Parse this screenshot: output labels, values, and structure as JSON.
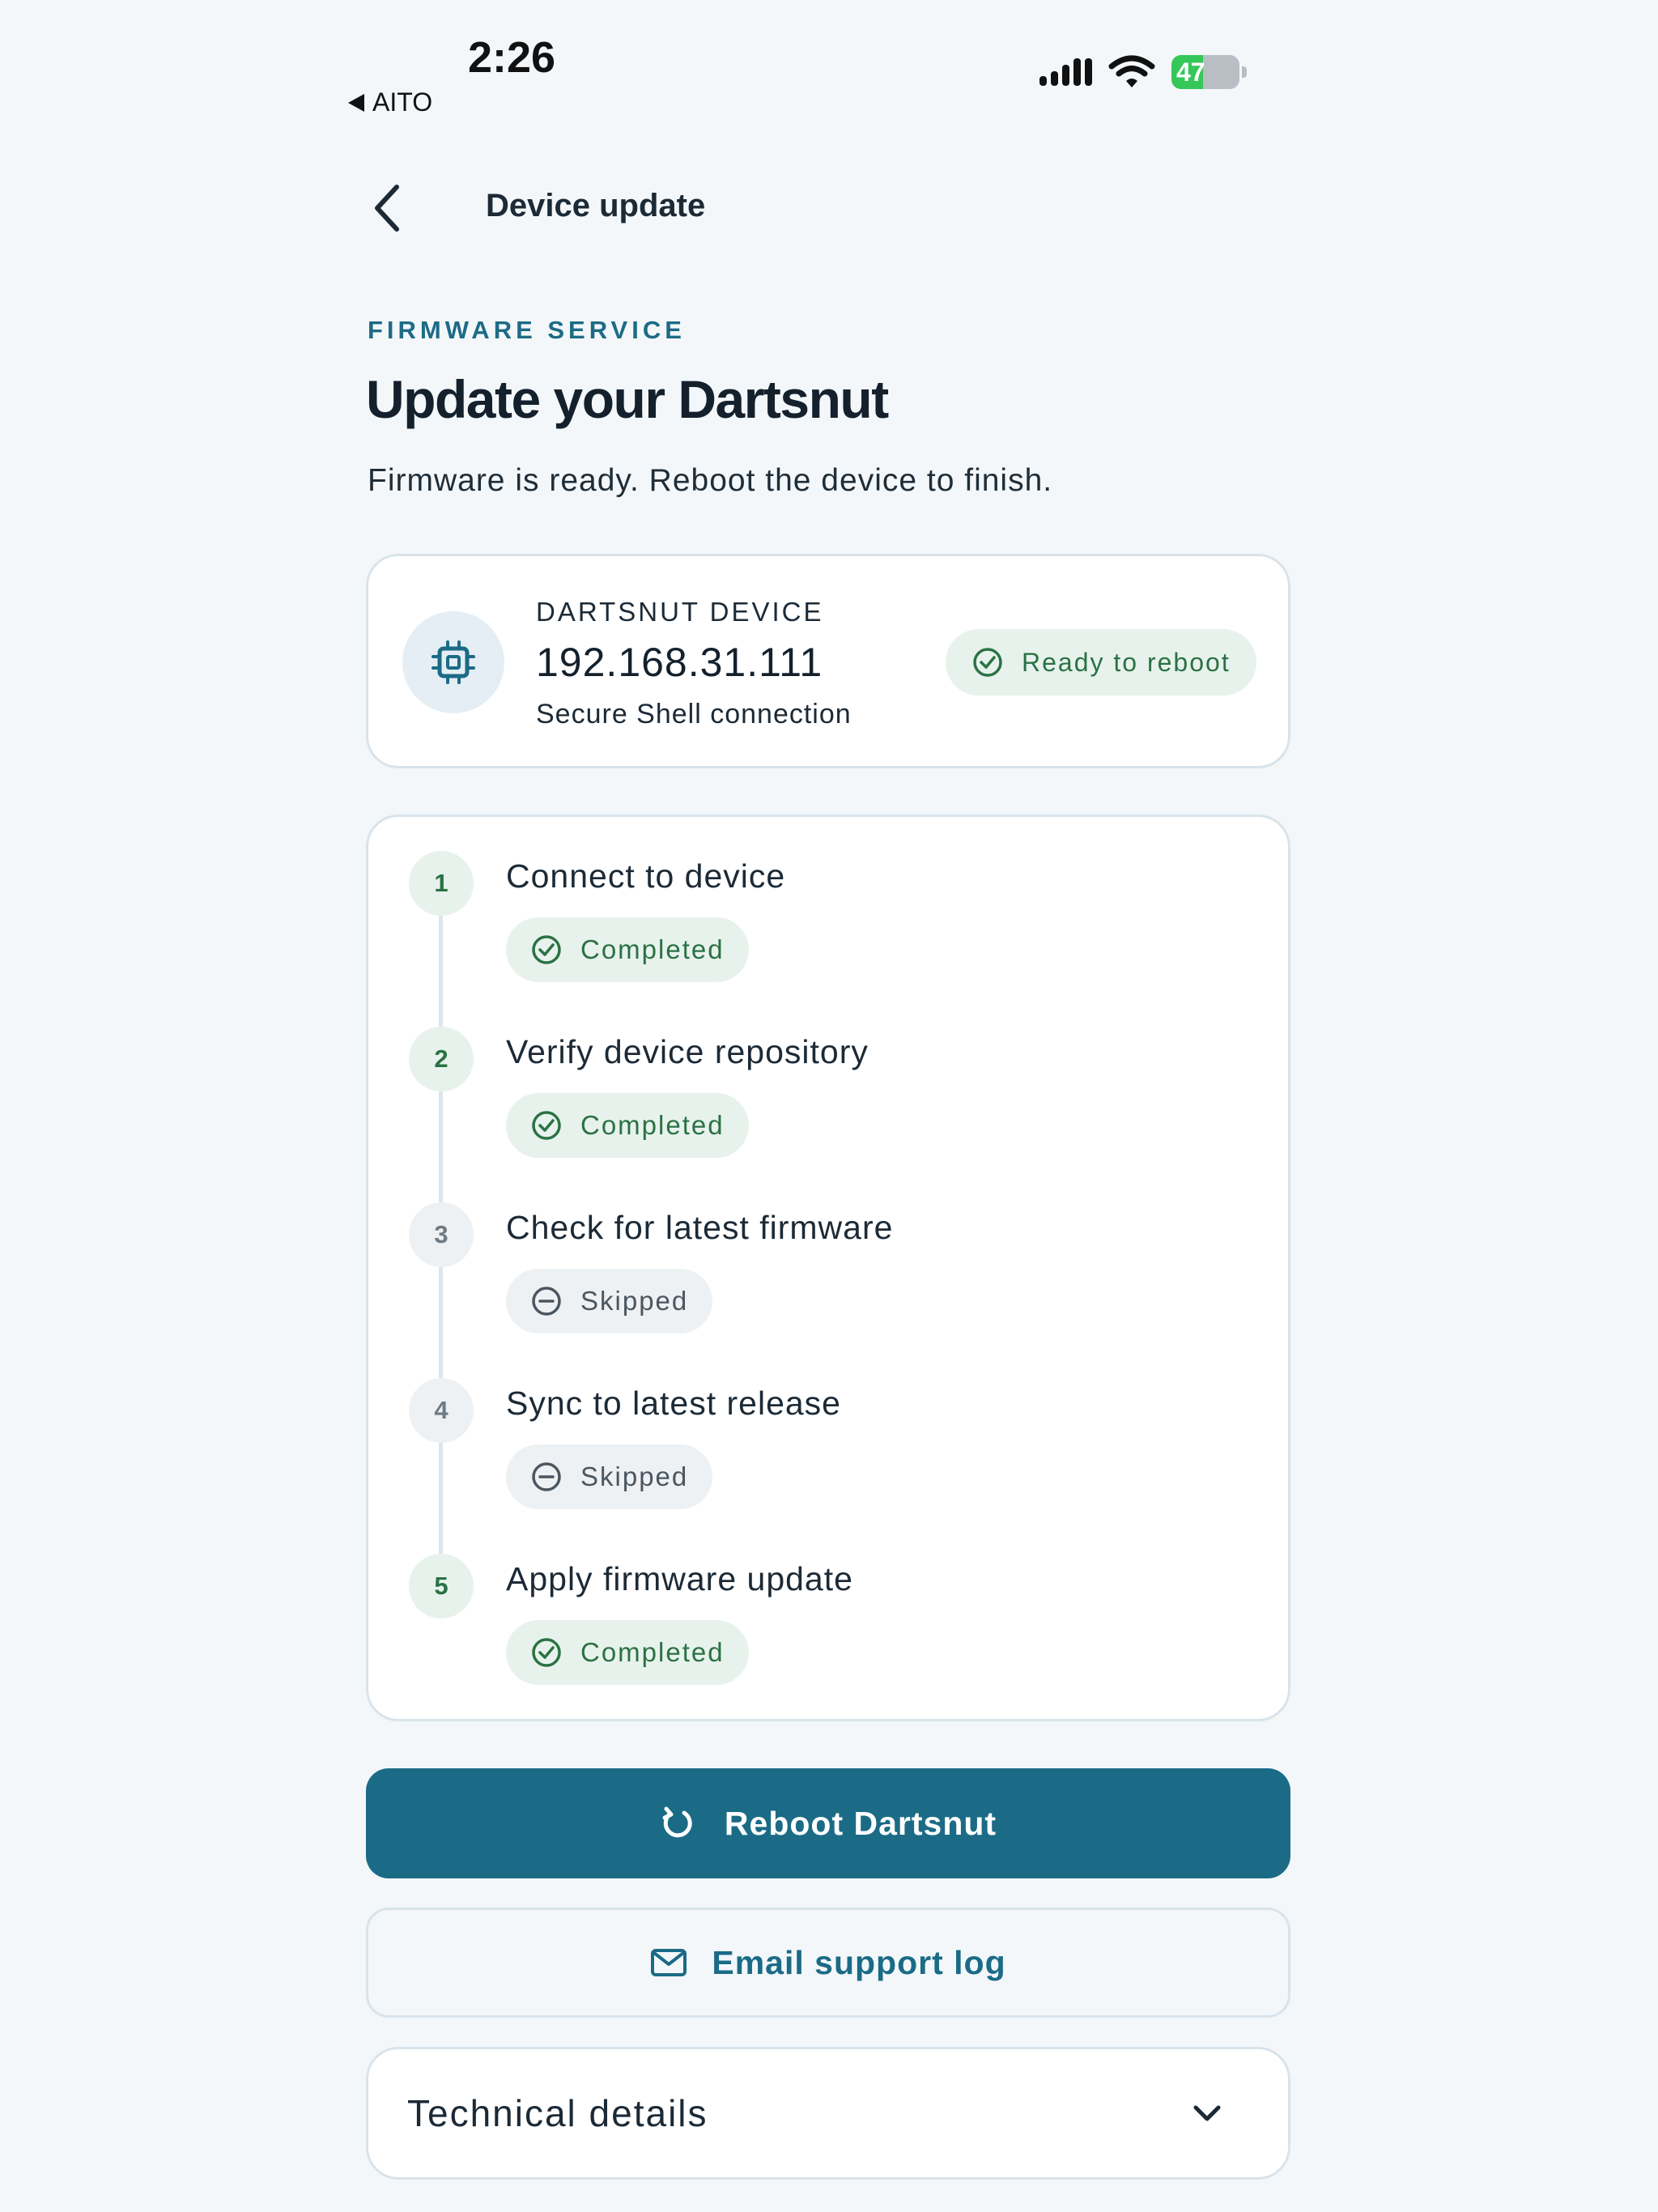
{
  "status_bar": {
    "time": "2:26",
    "back_app": "AITO",
    "battery": "47",
    "battery_level": 0.47
  },
  "header": {
    "title": "Device update"
  },
  "intro": {
    "eyebrow": "FIRMWARE SERVICE",
    "headline": "Update your Dartsnut",
    "subtitle": "Firmware is ready. Reboot the device to finish."
  },
  "device": {
    "label": "DARTSNUT DEVICE",
    "ip": "192.168.31.111",
    "connection": "Secure Shell connection",
    "status": "Ready to reboot",
    "icon": "chip-icon"
  },
  "steps": [
    {
      "number": "1",
      "title": "Connect to device",
      "status": "Completed",
      "state": "done"
    },
    {
      "number": "2",
      "title": "Verify device repository",
      "status": "Completed",
      "state": "done"
    },
    {
      "number": "3",
      "title": "Check for latest firmware",
      "status": "Skipped",
      "state": "skip"
    },
    {
      "number": "4",
      "title": "Sync to latest release",
      "status": "Skipped",
      "state": "skip"
    },
    {
      "number": "5",
      "title": "Apply firmware update",
      "status": "Completed",
      "state": "done"
    }
  ],
  "actions": {
    "primary_label": "Reboot Dartsnut",
    "secondary_label": "Email support log",
    "details_label": "Technical details"
  },
  "colors": {
    "accent": "#1b6b86",
    "success": "#2a7244",
    "success_bg": "#e8f2ec",
    "neutral_bg": "#eef1f3",
    "background": "#f3f7fa"
  }
}
